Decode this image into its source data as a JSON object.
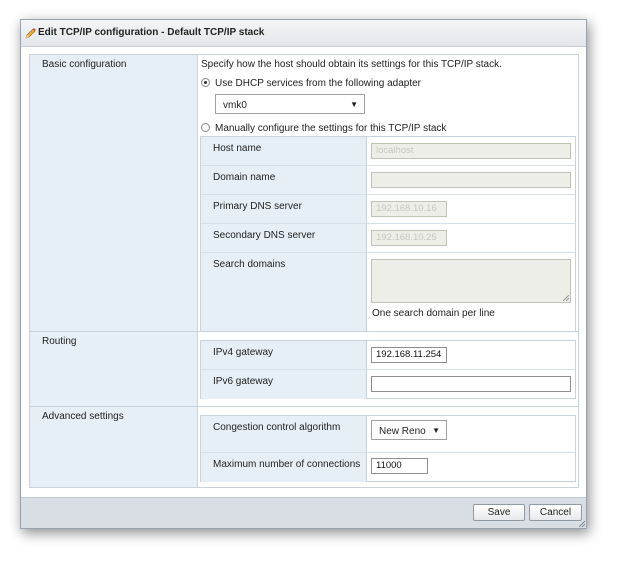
{
  "dialog": {
    "title": "Edit TCP/IP configuration - Default TCP/IP stack"
  },
  "basic": {
    "section_label": "Basic configuration",
    "description": "Specify how the host should obtain its settings for this TCP/IP stack.",
    "dhcp_option": "Use DHCP services from the following adapter",
    "adapter_selected": "vmk0",
    "manual_option": "Manually configure the settings for this TCP/IP stack",
    "fields": {
      "host_name_label": "Host name",
      "host_name_value": "localhost",
      "domain_name_label": "Domain name",
      "domain_name_value": "",
      "primary_dns_label": "Primary DNS server",
      "primary_dns_value": "192.168.10.16",
      "secondary_dns_label": "Secondary DNS server",
      "secondary_dns_value": "192.168.10.25",
      "search_domains_label": "Search domains",
      "search_domains_hint": "One search domain per line"
    }
  },
  "routing": {
    "section_label": "Routing",
    "ipv4_label": "IPv4 gateway",
    "ipv4_value": "192.168.11.254",
    "ipv6_label": "IPv6 gateway",
    "ipv6_value": ""
  },
  "advanced": {
    "section_label": "Advanced settings",
    "congestion_label": "Congestion control algorithm",
    "congestion_value": "New Reno",
    "max_conn_label": "Maximum number of connections",
    "max_conn_value": "11000"
  },
  "footer": {
    "save_label": "Save",
    "cancel_label": "Cancel"
  },
  "icons": {
    "title_icon": "pencil-icon",
    "dropdown_arrow": "▼"
  }
}
